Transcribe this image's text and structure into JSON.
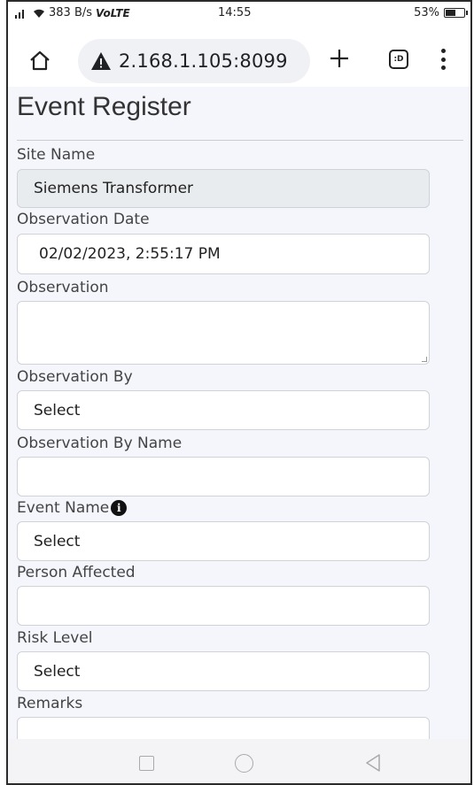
{
  "status_bar": {
    "signal": " ͢ᴵᴵ",
    "speed": "383 B/s",
    "network": "VoLTE",
    "time": "14:55",
    "battery": "53%",
    "battery_level": 0.53
  },
  "browser": {
    "url": "2.168.1.105:8099",
    "tabs_icon_text": ":D"
  },
  "page": {
    "title": "Event Register",
    "fields": {
      "site_name": {
        "label": "Site Name",
        "value": "Siemens Transformer"
      },
      "observation_date": {
        "label": "Observation Date",
        "value": "02/02/2023, 2:55:17 PM"
      },
      "observation": {
        "label": "Observation",
        "value": ""
      },
      "observation_by": {
        "label": "Observation By",
        "value": "Select"
      },
      "observation_by_name": {
        "label": "Observation By Name",
        "value": ""
      },
      "event_name": {
        "label": "Event Name",
        "value": "Select"
      },
      "person_affected": {
        "label": "Person Affected",
        "value": ""
      },
      "risk_level": {
        "label": "Risk Level",
        "value": "Select"
      },
      "remarks": {
        "label": "Remarks",
        "value": ""
      }
    }
  },
  "colors": {
    "page_background": "#f4f6fb",
    "readonly_field": "#e9ecef",
    "url_box": "#f0f1f5"
  }
}
